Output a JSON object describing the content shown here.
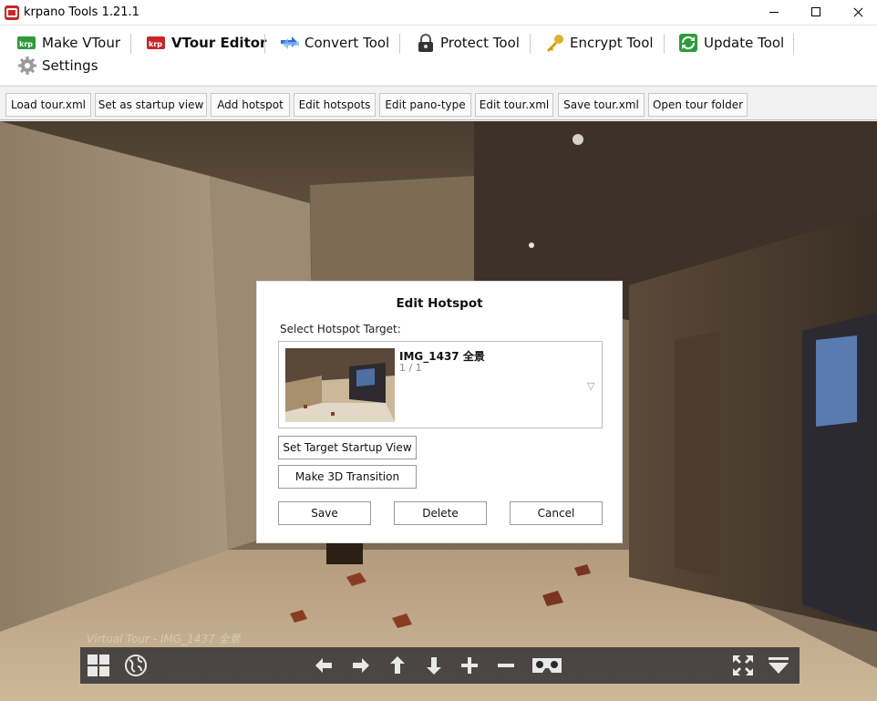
{
  "window": {
    "title": "krpano Tools 1.21.1"
  },
  "menu": {
    "make_vtour": "Make VTour",
    "vtour_editor": "VTour Editor",
    "convert_tool": "Convert Tool",
    "protect_tool": "Protect Tool",
    "encrypt_tool": "Encrypt Tool",
    "update_tool": "Update Tool",
    "settings": "Settings"
  },
  "toolbar": {
    "load": "Load tour.xml",
    "startup": "Set as startup view",
    "add_hotspot": "Add hotspot",
    "edit_hotspots": "Edit hotspots",
    "edit_panotype": "Edit pano-type",
    "edit_tourxml": "Edit tour.xml",
    "save_tourxml": "Save tour.xml",
    "open_folder": "Open tour folder"
  },
  "dialog": {
    "title": "Edit Hotspot",
    "select_label": "Select Hotspot Target:",
    "target_name": "IMG_1437 全景",
    "target_count": "1 / 1",
    "dropdown_arrow": "▽",
    "set_startup": "Set Target Startup View",
    "make_3d": "Make 3D Transition",
    "save": "Save",
    "delete": "Delete",
    "cancel": "Cancel"
  },
  "viewer": {
    "caption": "Virtual Tour - IMG_1437 全景",
    "controls": [
      "thumbs-grid-icon",
      "globe-icon",
      "arrow-left-icon",
      "arrow-right-icon",
      "arrow-up-icon",
      "arrow-down-icon",
      "zoom-in-icon",
      "zoom-out-icon",
      "vr-headset-icon",
      "fullscreen-icon",
      "hide-controls-icon"
    ]
  },
  "colors": {
    "accent_red": "#c62828",
    "green": "#2e9b3a",
    "blue": "#2f6fd6"
  }
}
